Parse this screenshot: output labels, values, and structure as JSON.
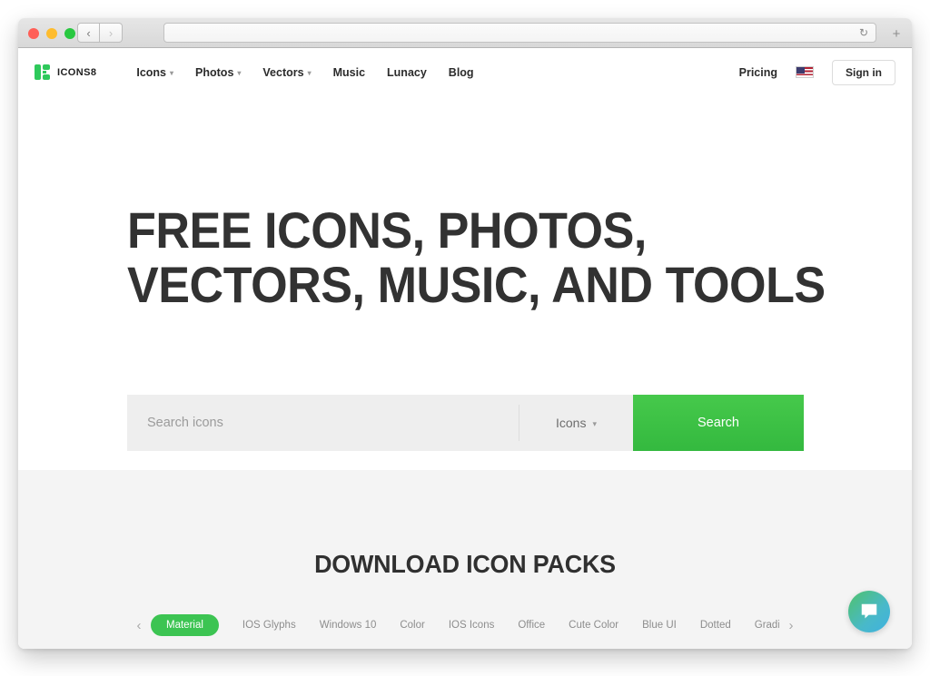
{
  "browser": {
    "url_value": "",
    "url_placeholder": "",
    "reload_icon": "↻",
    "back_icon": "‹",
    "forward_icon": "›",
    "new_tab_icon": "+"
  },
  "header": {
    "brand_name": "ICONS8",
    "nav": [
      {
        "label": "Icons",
        "has_caret": true
      },
      {
        "label": "Photos",
        "has_caret": true
      },
      {
        "label": "Vectors",
        "has_caret": true
      },
      {
        "label": "Music",
        "has_caret": false
      },
      {
        "label": "Lunacy",
        "has_caret": false
      },
      {
        "label": "Blog",
        "has_caret": false
      }
    ],
    "pricing_label": "Pricing",
    "language_flag": "us-flag-icon",
    "signin_label": "Sign in"
  },
  "hero": {
    "title": "FREE ICONS, PHOTOS,\nVECTORS, MUSIC, AND TOOLS",
    "search_placeholder": "Search icons",
    "search_value": "",
    "type_label": "Icons",
    "search_button_label": "Search"
  },
  "packs": {
    "title": "DOWNLOAD ICON PACKS",
    "prev_arrow": "‹",
    "next_arrow": "›",
    "tabs": [
      {
        "label": "Material",
        "active": true
      },
      {
        "label": "IOS Glyphs",
        "active": false
      },
      {
        "label": "Windows 10",
        "active": false
      },
      {
        "label": "Color",
        "active": false
      },
      {
        "label": "IOS Icons",
        "active": false
      },
      {
        "label": "Office",
        "active": false
      },
      {
        "label": "Cute Color",
        "active": false
      },
      {
        "label": "Blue UI",
        "active": false
      },
      {
        "label": "Dotted",
        "active": false
      },
      {
        "label": "Gradient Line",
        "active": false
      }
    ]
  },
  "chat": {
    "icon": "chat-bubble-icon"
  },
  "colors": {
    "brand_green": "#2ec95b",
    "search_green": "#3cc452",
    "pill_green": "#3cc452",
    "heading_gray": "#323232",
    "section_gray": "#f4f4f4",
    "input_gray": "#eeeeee"
  }
}
